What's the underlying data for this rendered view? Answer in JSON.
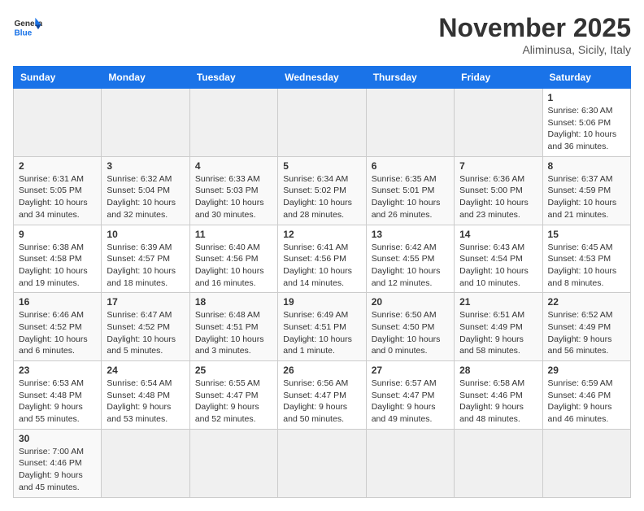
{
  "header": {
    "logo_general": "General",
    "logo_blue": "Blue",
    "month_title": "November 2025",
    "location": "Aliminusa, Sicily, Italy"
  },
  "days_of_week": [
    "Sunday",
    "Monday",
    "Tuesday",
    "Wednesday",
    "Thursday",
    "Friday",
    "Saturday"
  ],
  "weeks": [
    [
      {
        "day": "",
        "info": ""
      },
      {
        "day": "",
        "info": ""
      },
      {
        "day": "",
        "info": ""
      },
      {
        "day": "",
        "info": ""
      },
      {
        "day": "",
        "info": ""
      },
      {
        "day": "",
        "info": ""
      },
      {
        "day": "1",
        "info": "Sunrise: 6:30 AM\nSunset: 5:06 PM\nDaylight: 10 hours and 36 minutes."
      }
    ],
    [
      {
        "day": "2",
        "info": "Sunrise: 6:31 AM\nSunset: 5:05 PM\nDaylight: 10 hours and 34 minutes."
      },
      {
        "day": "3",
        "info": "Sunrise: 6:32 AM\nSunset: 5:04 PM\nDaylight: 10 hours and 32 minutes."
      },
      {
        "day": "4",
        "info": "Sunrise: 6:33 AM\nSunset: 5:03 PM\nDaylight: 10 hours and 30 minutes."
      },
      {
        "day": "5",
        "info": "Sunrise: 6:34 AM\nSunset: 5:02 PM\nDaylight: 10 hours and 28 minutes."
      },
      {
        "day": "6",
        "info": "Sunrise: 6:35 AM\nSunset: 5:01 PM\nDaylight: 10 hours and 26 minutes."
      },
      {
        "day": "7",
        "info": "Sunrise: 6:36 AM\nSunset: 5:00 PM\nDaylight: 10 hours and 23 minutes."
      },
      {
        "day": "8",
        "info": "Sunrise: 6:37 AM\nSunset: 4:59 PM\nDaylight: 10 hours and 21 minutes."
      }
    ],
    [
      {
        "day": "9",
        "info": "Sunrise: 6:38 AM\nSunset: 4:58 PM\nDaylight: 10 hours and 19 minutes."
      },
      {
        "day": "10",
        "info": "Sunrise: 6:39 AM\nSunset: 4:57 PM\nDaylight: 10 hours and 18 minutes."
      },
      {
        "day": "11",
        "info": "Sunrise: 6:40 AM\nSunset: 4:56 PM\nDaylight: 10 hours and 16 minutes."
      },
      {
        "day": "12",
        "info": "Sunrise: 6:41 AM\nSunset: 4:56 PM\nDaylight: 10 hours and 14 minutes."
      },
      {
        "day": "13",
        "info": "Sunrise: 6:42 AM\nSunset: 4:55 PM\nDaylight: 10 hours and 12 minutes."
      },
      {
        "day": "14",
        "info": "Sunrise: 6:43 AM\nSunset: 4:54 PM\nDaylight: 10 hours and 10 minutes."
      },
      {
        "day": "15",
        "info": "Sunrise: 6:45 AM\nSunset: 4:53 PM\nDaylight: 10 hours and 8 minutes."
      }
    ],
    [
      {
        "day": "16",
        "info": "Sunrise: 6:46 AM\nSunset: 4:52 PM\nDaylight: 10 hours and 6 minutes."
      },
      {
        "day": "17",
        "info": "Sunrise: 6:47 AM\nSunset: 4:52 PM\nDaylight: 10 hours and 5 minutes."
      },
      {
        "day": "18",
        "info": "Sunrise: 6:48 AM\nSunset: 4:51 PM\nDaylight: 10 hours and 3 minutes."
      },
      {
        "day": "19",
        "info": "Sunrise: 6:49 AM\nSunset: 4:51 PM\nDaylight: 10 hours and 1 minute."
      },
      {
        "day": "20",
        "info": "Sunrise: 6:50 AM\nSunset: 4:50 PM\nDaylight: 10 hours and 0 minutes."
      },
      {
        "day": "21",
        "info": "Sunrise: 6:51 AM\nSunset: 4:49 PM\nDaylight: 9 hours and 58 minutes."
      },
      {
        "day": "22",
        "info": "Sunrise: 6:52 AM\nSunset: 4:49 PM\nDaylight: 9 hours and 56 minutes."
      }
    ],
    [
      {
        "day": "23",
        "info": "Sunrise: 6:53 AM\nSunset: 4:48 PM\nDaylight: 9 hours and 55 minutes."
      },
      {
        "day": "24",
        "info": "Sunrise: 6:54 AM\nSunset: 4:48 PM\nDaylight: 9 hours and 53 minutes."
      },
      {
        "day": "25",
        "info": "Sunrise: 6:55 AM\nSunset: 4:47 PM\nDaylight: 9 hours and 52 minutes."
      },
      {
        "day": "26",
        "info": "Sunrise: 6:56 AM\nSunset: 4:47 PM\nDaylight: 9 hours and 50 minutes."
      },
      {
        "day": "27",
        "info": "Sunrise: 6:57 AM\nSunset: 4:47 PM\nDaylight: 9 hours and 49 minutes."
      },
      {
        "day": "28",
        "info": "Sunrise: 6:58 AM\nSunset: 4:46 PM\nDaylight: 9 hours and 48 minutes."
      },
      {
        "day": "29",
        "info": "Sunrise: 6:59 AM\nSunset: 4:46 PM\nDaylight: 9 hours and 46 minutes."
      }
    ],
    [
      {
        "day": "30",
        "info": "Sunrise: 7:00 AM\nSunset: 4:46 PM\nDaylight: 9 hours and 45 minutes."
      },
      {
        "day": "",
        "info": ""
      },
      {
        "day": "",
        "info": ""
      },
      {
        "day": "",
        "info": ""
      },
      {
        "day": "",
        "info": ""
      },
      {
        "day": "",
        "info": ""
      },
      {
        "day": "",
        "info": ""
      }
    ]
  ]
}
